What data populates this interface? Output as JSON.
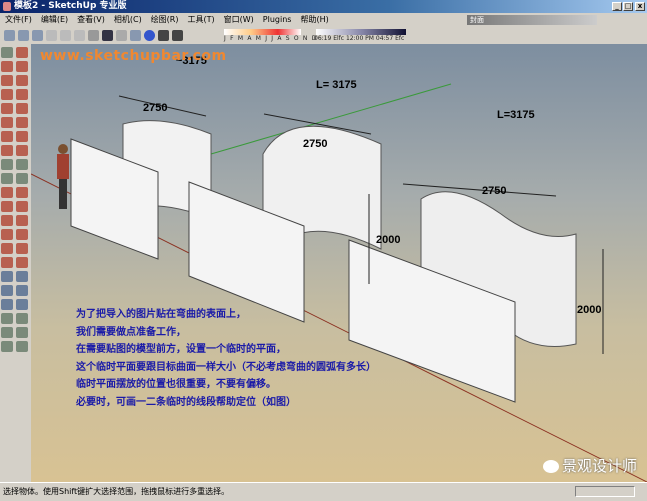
{
  "window": {
    "title": "模板2 - SketchUp 专业版",
    "min": "_",
    "max": "□",
    "close": "x"
  },
  "menu": [
    "文件(F)",
    "编辑(E)",
    "查看(V)",
    "相机(C)",
    "绘图(R)",
    "工具(T)",
    "窗口(W)",
    "Plugins",
    "帮助(H)"
  ],
  "layer": {
    "value": "封面"
  },
  "shadow": {
    "months": "J F M A M J J A S O N D",
    "times": "06:19 Elfc  12:00 PM  04:57 Efc"
  },
  "viewport": {
    "website": "www.sketchupbar.com",
    "dimensions": {
      "l1": "~3175",
      "w1": "2750",
      "l2": "L= 3175",
      "w2": "2750",
      "h2": "2000",
      "l3": "L=3175",
      "w3": "2750",
      "h3": "2000"
    },
    "note_lines": [
      "为了把导入的图片贴在弯曲的表面上，",
      "我们需要做点准备工作，",
      "在需要贴图的模型前方，设置一个临时的平面，",
      "这个临时平面要跟目标曲面一样大小（不必考虑弯曲的圆弧有多长）",
      "临时平面摆放的位置也很重要，不要有偏移。",
      "必要时，可画一二条临时的线段帮助定位（如图）"
    ],
    "watermark": "景观设计师"
  },
  "status": {
    "text": "选择物体。使用Shift键扩大选择范围，拖拽鼠标进行多重选择。"
  }
}
